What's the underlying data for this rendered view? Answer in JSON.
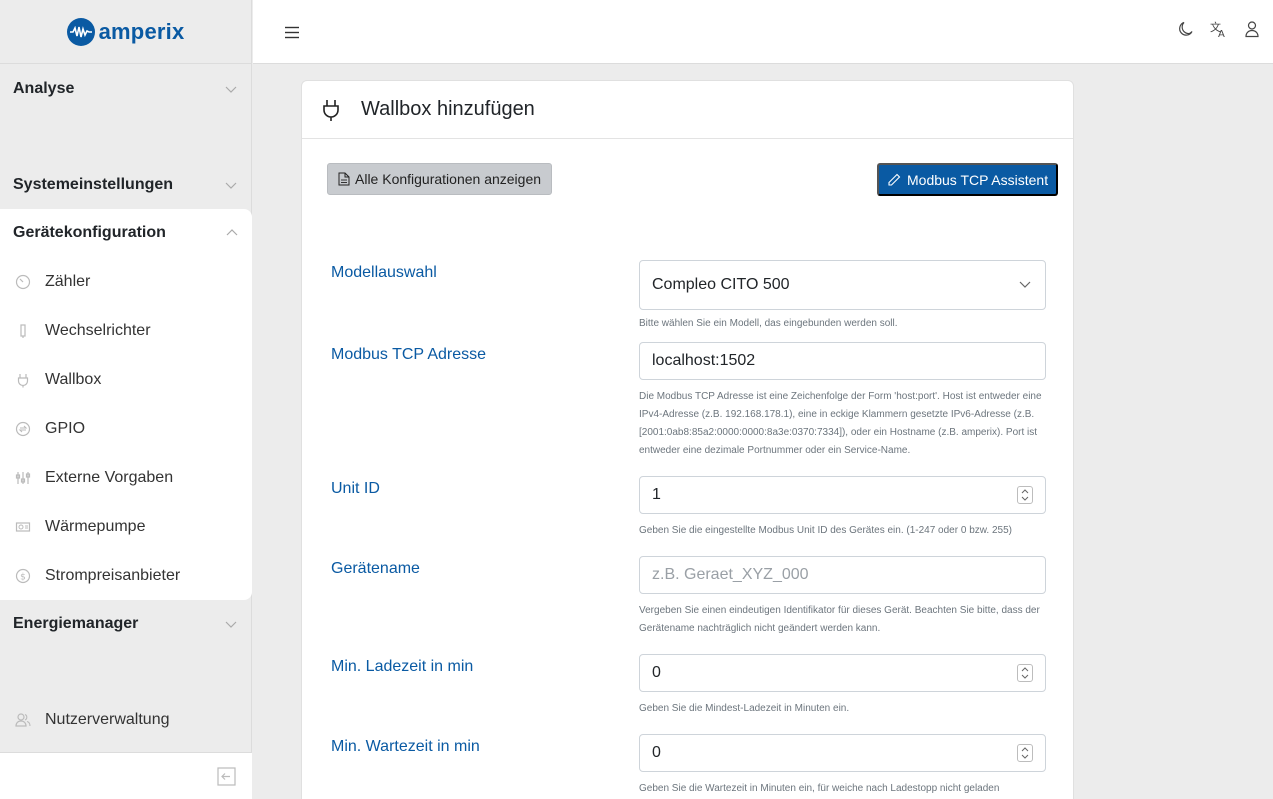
{
  "brand": {
    "name": "amperix",
    "accent_color": "#0a5aa3"
  },
  "sidebar": {
    "sections": [
      {
        "label": "Analyse",
        "expanded": false
      },
      {
        "label": "Systemeinstellungen",
        "expanded": false
      },
      {
        "label": "Gerätekonfiguration",
        "expanded": true
      },
      {
        "label": "Energiemanager",
        "expanded": false
      }
    ],
    "items": [
      {
        "label": "Zähler",
        "icon": "gauge-icon"
      },
      {
        "label": "Wechselrichter",
        "icon": "inverter-icon"
      },
      {
        "label": "Wallbox",
        "icon": "plug-icon"
      },
      {
        "label": "GPIO",
        "icon": "gpio-icon"
      },
      {
        "label": "Externe Vorgaben",
        "icon": "sliders-icon"
      },
      {
        "label": "Wärmepumpe",
        "icon": "heatpump-icon"
      },
      {
        "label": "Strompreisanbieter",
        "icon": "currency-icon"
      }
    ],
    "user_management": "Nutzerverwaltung"
  },
  "page": {
    "title": "Wallbox hinzufügen",
    "show_all_configs": "Alle Konfigurationen anzeigen",
    "modbus_assistant": "Modbus TCP Assistent"
  },
  "form": {
    "model": {
      "label": "Modellauswahl",
      "value": "Compleo CITO 500",
      "help": "Bitte wählen Sie ein Modell, das eingebunden werden soll."
    },
    "address": {
      "label": "Modbus TCP Adresse",
      "value": "localhost:1502",
      "help": "Die Modbus TCP Adresse ist eine Zeichenfolge der Form 'host:port'. Host ist entweder eine IPv4-Adresse (z.B. 192.168.178.1), eine in eckige Klammern gesetzte IPv6-Adresse (z.B. [2001:0ab8:85a2:0000:0000:8a3e:0370:7334]), oder ein Hostname (z.B. amperix). Port ist entweder eine dezimale Portnummer oder ein Service-Name."
    },
    "unit_id": {
      "label": "Unit ID",
      "value": "1",
      "help": "Geben Sie die eingestellte Modbus Unit ID des Gerätes ein. (1-247 oder 0 bzw. 255)"
    },
    "device_name": {
      "label": "Gerätename",
      "placeholder": "z.B. Geraet_XYZ_000",
      "help": "Vergeben Sie einen eindeutigen Identifikator für dieses Gerät. Beachten Sie bitte, dass der Gerätename nachträglich nicht geändert werden kann."
    },
    "min_charge": {
      "label": "Min. Ladezeit in min",
      "value": "0",
      "help": "Geben Sie die Mindest-Ladezeit in Minuten ein."
    },
    "min_wait": {
      "label": "Min. Wartezeit in min",
      "value": "0",
      "help": "Geben Sie die Wartezeit in Minuten ein, für weiche nach Ladestopp nicht geladen"
    }
  }
}
